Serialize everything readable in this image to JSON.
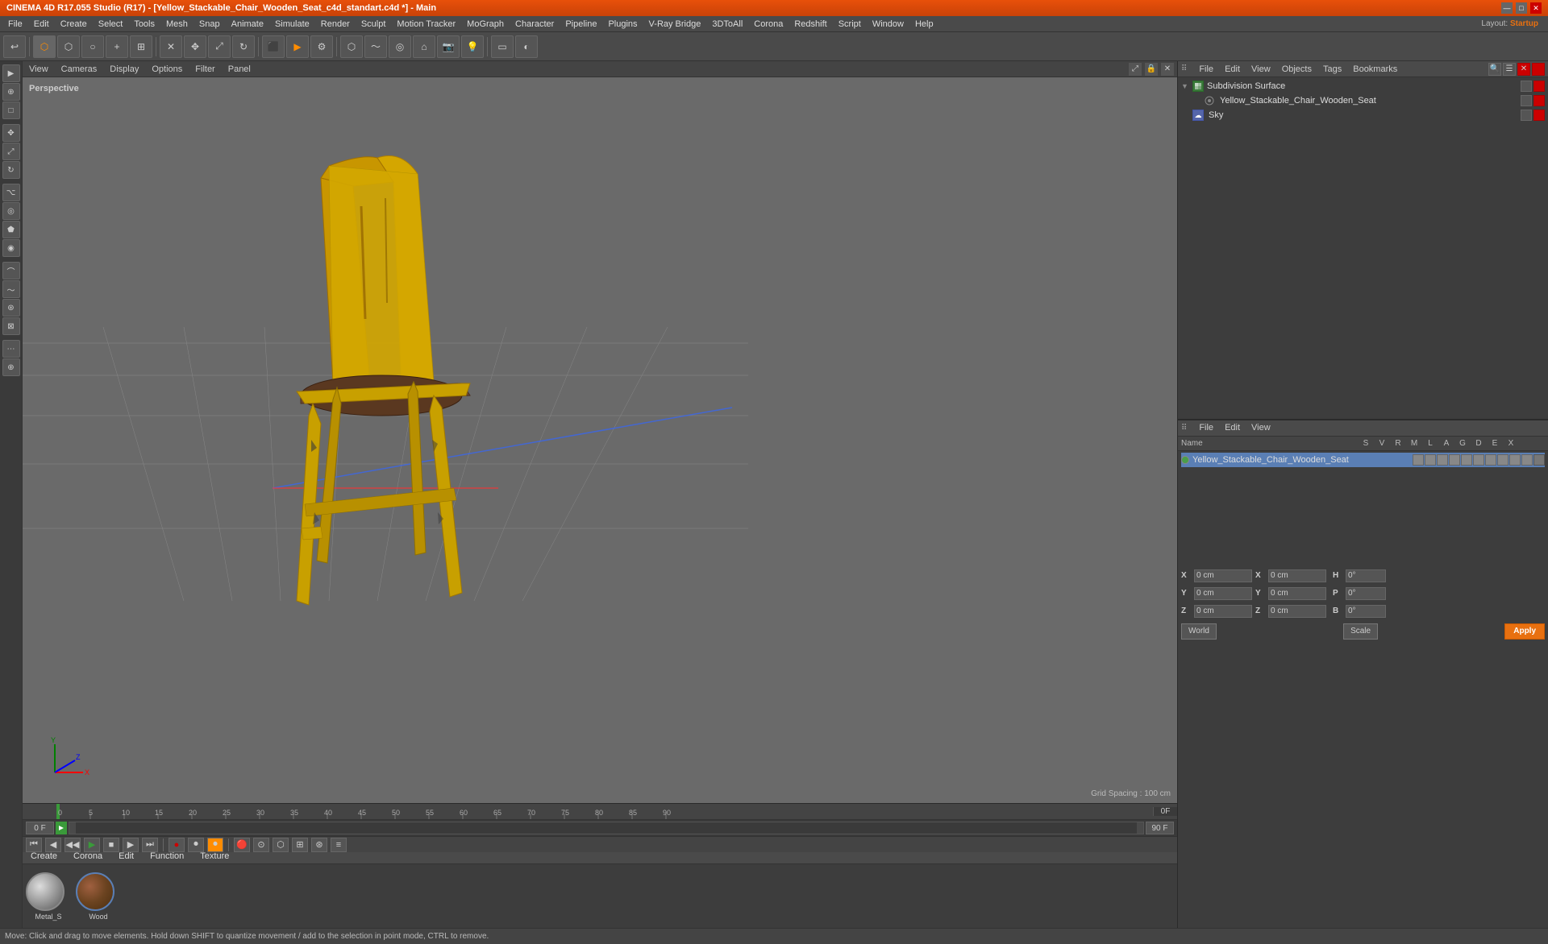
{
  "app": {
    "title": "CINEMA 4D R17.055 Studio (R17) - [Yellow_Stackable_Chair_Wooden_Seat_c4d_standart.c4d *] - Main",
    "layout_label": "Layout:",
    "layout_value": "Startup"
  },
  "menu_bar": {
    "items": [
      "File",
      "Edit",
      "Create",
      "Select",
      "Tools",
      "Mesh",
      "Snap",
      "Animate",
      "Simulate",
      "Render",
      "Sculpt",
      "Motion Tracker",
      "MoGraph",
      "Character",
      "Pipeline",
      "Plugins",
      "V-Ray Bridge",
      "3DToAll",
      "Corona",
      "Redshift",
      "Script",
      "Window",
      "Help"
    ]
  },
  "viewport": {
    "tabs": [
      "View",
      "Cameras",
      "Display",
      "Options",
      "Filter",
      "Panel"
    ],
    "perspective_label": "Perspective",
    "grid_spacing": "Grid Spacing : 100 cm"
  },
  "object_manager": {
    "title": "",
    "menus": [
      "File",
      "Edit",
      "View",
      "Objects",
      "Tags",
      "Bookmarks"
    ],
    "items": [
      {
        "name": "Subdivision Surface",
        "type": "subdivision",
        "indent": 0,
        "dot_color": "gray"
      },
      {
        "name": "Yellow_Stackable_Chair_Wooden_Seat",
        "type": "object",
        "indent": 1,
        "dot_color": "gray"
      },
      {
        "name": "Sky",
        "type": "sky",
        "indent": 0,
        "dot_color": "gray"
      }
    ]
  },
  "attribute_manager": {
    "menus": [
      "File",
      "Edit",
      "View"
    ],
    "columns": [
      "Name",
      "S",
      "V",
      "R",
      "M",
      "L",
      "A",
      "G",
      "D",
      "E",
      "X"
    ],
    "items": [
      {
        "name": "Yellow_Stackable_Chair_Wooden_Seat",
        "dot_color": "green"
      }
    ]
  },
  "timeline": {
    "markers": [
      "0",
      "5",
      "10",
      "15",
      "20",
      "25",
      "30",
      "35",
      "40",
      "45",
      "50",
      "55",
      "60",
      "65",
      "70",
      "75",
      "80",
      "85",
      "90"
    ],
    "current_frame": "0 F",
    "fps": "0",
    "start_frame": "0 F",
    "end_frame": "90 F"
  },
  "material_editor": {
    "menus": [
      "Create",
      "Corona",
      "Edit",
      "Function",
      "Texture"
    ],
    "materials": [
      {
        "name": "Metal_S",
        "color_top": "#c8c8c8",
        "color_mid": "#888",
        "color_bot": "#555"
      },
      {
        "name": "Wood",
        "color_top": "#8b6340",
        "color_mid": "#6b4320",
        "color_bot": "#4a2e10"
      }
    ]
  },
  "coordinates": {
    "x_pos": "0 cm",
    "y_pos": "0 cm",
    "z_pos": "0 cm",
    "x_rot": "0 cm",
    "y_rot": "0 cm",
    "z_rot": "0 cm",
    "h_val": "0°",
    "p_val": "0°",
    "b_val": "0°",
    "world_btn": "World",
    "scale_btn": "Scale",
    "apply_btn": "Apply"
  },
  "status_bar": {
    "message": "Move: Click and drag to move elements. Hold down SHIFT to quantize movement / add to the selection in point mode, CTRL to remove."
  },
  "icons": {
    "move": "✥",
    "rotate": "↻",
    "scale": "⤢",
    "select": "▶",
    "play": "▶",
    "stop": "■",
    "rewind": "⏮",
    "forward": "⏭",
    "record": "⏺"
  }
}
